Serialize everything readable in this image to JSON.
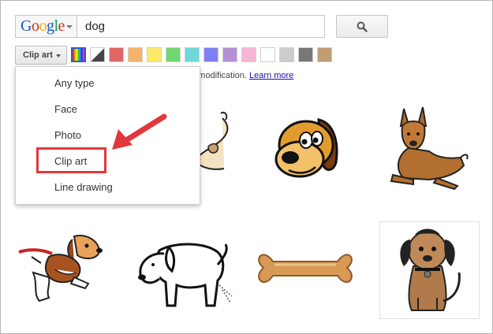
{
  "search": {
    "brand_word": [
      {
        "ch": "G",
        "color": "#1a53c4"
      },
      {
        "ch": "o",
        "color": "#d62d20"
      },
      {
        "ch": "o",
        "color": "#f4b400"
      },
      {
        "ch": "g",
        "color": "#1a53c4"
      },
      {
        "ch": "l",
        "color": "#0f9d58"
      },
      {
        "ch": "e",
        "color": "#d62d20"
      }
    ],
    "query": "dog",
    "submit_icon": "search-icon"
  },
  "toolbar": {
    "type_label": "Clip art",
    "color_swatches": [
      "full-color",
      "black-and-white",
      "#e06666",
      "#f6b26b",
      "#ffe968",
      "#6fd86f",
      "#6ed9d9",
      "#7f7ff5",
      "#b491d6",
      "#f8b6d6",
      "#ffffff",
      "#cccccc",
      "#777777",
      "#c29c73"
    ]
  },
  "notice": {
    "text": "n modification.",
    "link": "Learn more"
  },
  "type_menu": {
    "items": [
      "Any type",
      "Face",
      "Photo",
      "Clip art",
      "Line drawing"
    ],
    "selected": "Clip art"
  },
  "colors": {
    "highlight": "#e0383c",
    "arrow": "#e0383c",
    "link": "#1a0dab"
  },
  "results": [
    "partial-clipart",
    "cartoon-dog-face",
    "lying-brown-dog",
    "beagle-on-leash",
    "outline-dog",
    "dog-bone",
    "sitting-dog"
  ]
}
